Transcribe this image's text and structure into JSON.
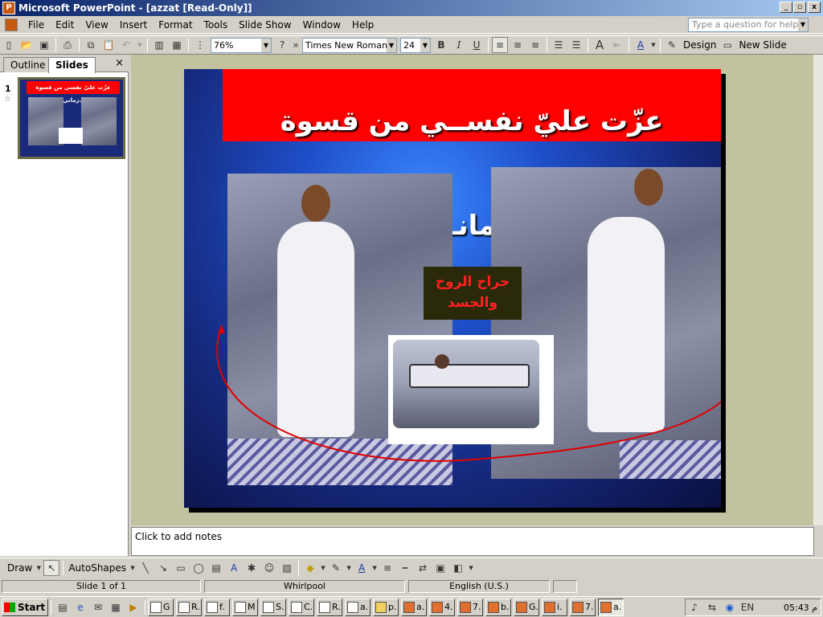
{
  "window": {
    "title": "Microsoft PowerPoint - [azzat [Read-Only]]"
  },
  "menus": [
    "File",
    "Edit",
    "View",
    "Insert",
    "Format",
    "Tools",
    "Slide Show",
    "Window",
    "Help"
  ],
  "help": {
    "placeholder": "Type a question for help"
  },
  "toolbar": {
    "zoom": "76%",
    "font": "Times New Roman",
    "size": "24",
    "bold": "B",
    "italic": "I",
    "underline": "U",
    "design": "Design",
    "new_slide": "New Slide"
  },
  "left_pane": {
    "tabs": [
      "Outline",
      "Slides"
    ],
    "close": "×",
    "thumb_number": "1"
  },
  "slide": {
    "title": "عزّت عليّ نفســي من قسوة زمانــي..",
    "caption_line1": "جراح الروح",
    "caption_line2": "والجسد",
    "thumb_title": "عزّت عليّ نفسي من قسوة زماني.."
  },
  "notes": {
    "placeholder": "Click to add notes"
  },
  "drawing": {
    "draw": "Draw",
    "autoshapes": "AutoShapes"
  },
  "status": {
    "slide": "Slide 1 of 1",
    "design": "Whirlpool",
    "language": "English (U.S.)"
  },
  "taskbar": {
    "start": "Start",
    "buttons": [
      "G",
      "R.",
      "f.",
      "M",
      "S.",
      "C.",
      "R.",
      "a.",
      "p.",
      "a.",
      "4.",
      "7.",
      "b.",
      "G.",
      "i.",
      "7.",
      "a."
    ],
    "language": "EN",
    "clock": "05:43",
    "clock_suffix": "م"
  },
  "colors": {
    "title_red": "#ff0000",
    "caption_red": "#ff2020",
    "window_blue": "#0a246a",
    "workspace": "#c2c2a0"
  }
}
